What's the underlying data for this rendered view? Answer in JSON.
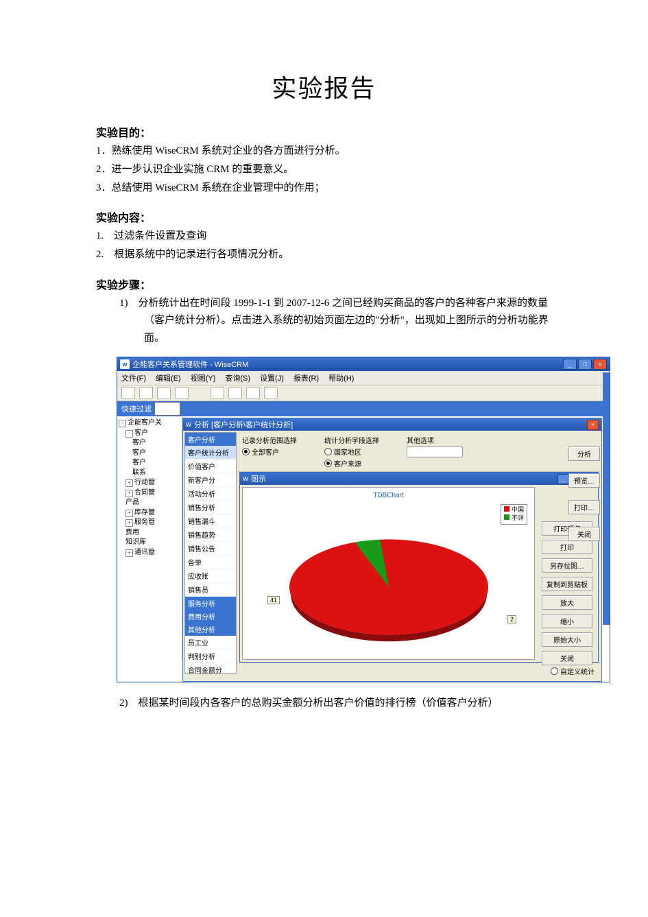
{
  "doc": {
    "title": "实验报告",
    "sec1_heading": "实验目的：",
    "purpose": [
      "1．熟练使用 WiseCRM 系统对企业的各方面进行分析。",
      "2．进一步认识企业实施 CRM 的重要意义。",
      "3．总结使用 WiseCRM 系统在企业管理中的作用；"
    ],
    "sec2_heading": "实验内容：",
    "content": [
      "1.　过滤条件设置及查询",
      "2.　根据系统中的记录进行各项情况分析。"
    ],
    "sec3_heading": "实验步骤：",
    "step1_num": "1)",
    "step1_text": "分析统计出在时间段 1999-1-1 到 2007-12-6 之间已经购买商品的客户的各种客户来源的数量（客户统计分析）。点击进入系统的初始页面左边的\"分析\"，出现如上图所示的分析功能界面。",
    "step2_num": "2)",
    "step2_text": "根据某时间段内各客户的总购买金额分析出客户价值的排行榜（价值客户分析）"
  },
  "app": {
    "window_title": "企能客户关系管理软件 - WiseCRM",
    "menus": [
      "文件(F)",
      "编辑(E)",
      "视图(Y)",
      "查询(S)",
      "设置(J)",
      "报表(R)",
      "帮助(H)"
    ],
    "filter_label": "快速过滤",
    "tree_root": "企能客户关",
    "tree_items": [
      "客户",
      "客户",
      "客户",
      "客户",
      "联系",
      "行动管",
      "合同管",
      "产品",
      "库存管",
      "服务管",
      "费用",
      "知识库",
      "通讯管"
    ],
    "analysis_title": "分析  [客户分析\\客户统计分析]",
    "side_groups": {
      "g1": "客户分析",
      "g1_items": [
        "客户统计分析",
        "价值客户",
        "新客户分",
        "活动分析",
        "销售分析",
        "销售漏斗",
        "销售趋势",
        "销售公告",
        "各单",
        "应收账",
        "销售员"
      ],
      "g2": "服务分析",
      "g3": "费用分析",
      "g4": "其他分析",
      "g4_items": [
        "员工业",
        "判别分析",
        "合同金额分"
      ]
    },
    "criteria": {
      "col1_label": "记录分析范围选择",
      "col1_opt": "全部客户",
      "col2_label": "统计分析字段选择",
      "col2_opts": [
        "国家地区",
        "客户来源"
      ],
      "col3_label": "其他选项"
    },
    "chart_dialog_title": "图示",
    "chart_title": "TDBChart",
    "legend": [
      "中国",
      "不详"
    ],
    "callout1": "41",
    "callout2": "2",
    "chart_buttons": [
      "打印预览",
      "打印",
      "另存位图…",
      "复制到剪贴板",
      "放大",
      "缩小",
      "原始大小",
      "关闭"
    ],
    "right_buttons": [
      "分析",
      "预览…",
      "打印…",
      "关闭"
    ],
    "footer_radio": "自定义统计"
  },
  "chart_data": {
    "type": "pie",
    "title": "TDBChart",
    "series": [
      {
        "name": "中国",
        "value": 41
      },
      {
        "name": "不详",
        "value": 2
      }
    ]
  }
}
